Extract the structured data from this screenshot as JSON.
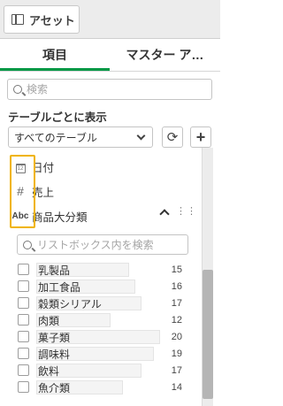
{
  "header": {
    "asset_label": "アセット"
  },
  "tabs": [
    {
      "label": "項目"
    },
    {
      "label": "マスター ア…"
    }
  ],
  "search": {
    "placeholder": "検索"
  },
  "section": {
    "title": "テーブルごとに表示"
  },
  "table_select": {
    "value": "すべてのテーブル"
  },
  "fields": [
    {
      "icon": "calendar-icon",
      "label": "日付"
    },
    {
      "icon": "hash-icon",
      "label": "売上"
    },
    {
      "icon": "abc-icon",
      "label": "商品大分類"
    }
  ],
  "listbox": {
    "search_placeholder": "リストボックス内を検索",
    "items": [
      {
        "label": "乳製品",
        "count": "15",
        "fill": 0.75
      },
      {
        "label": "加工食品",
        "count": "16",
        "fill": 0.8
      },
      {
        "label": "穀類シリアル",
        "count": "17",
        "fill": 0.85
      },
      {
        "label": "肉類",
        "count": "12",
        "fill": 0.6
      },
      {
        "label": "菓子類",
        "count": "20",
        "fill": 1.0
      },
      {
        "label": "調味料",
        "count": "19",
        "fill": 0.95
      },
      {
        "label": "飲料",
        "count": "17",
        "fill": 0.85
      },
      {
        "label": "魚介類",
        "count": "14",
        "fill": 0.7
      }
    ]
  },
  "colors": {
    "tab_accent": "#009845",
    "highlight": "#f0b400"
  }
}
